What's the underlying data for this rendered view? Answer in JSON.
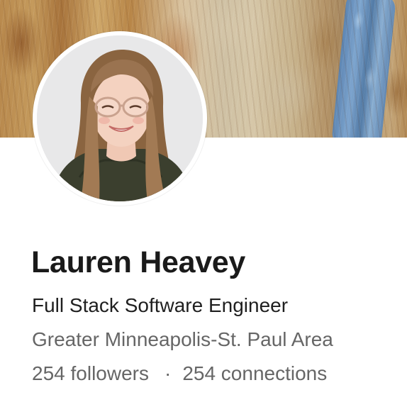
{
  "profile": {
    "name": "Lauren Heavey",
    "headline": "Full Stack Software Engineer",
    "location": "Greater Minneapolis-St. Paul Area",
    "followers_text": "254 followers",
    "separator": "·",
    "connections_text": "254 connections"
  },
  "icons": {
    "avatar": "profile-photo"
  },
  "colors": {
    "name": "#1a1a1a",
    "headline": "#1f1f1f",
    "secondary_text": "#666666",
    "background": "#ffffff"
  }
}
